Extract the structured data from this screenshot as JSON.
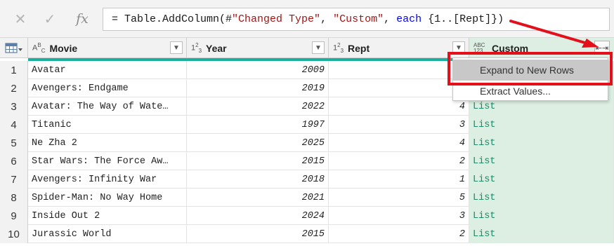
{
  "formula_bar": {
    "parts": [
      {
        "text": "= Table.AddColumn(#",
        "kind": "plain"
      },
      {
        "text": "\"Changed Type\"",
        "kind": "str"
      },
      {
        "text": ", ",
        "kind": "plain"
      },
      {
        "text": "\"Custom\"",
        "kind": "str"
      },
      {
        "text": ", ",
        "kind": "plain"
      },
      {
        "text": "each",
        "kind": "kw"
      },
      {
        "text": " {1..[Rept]})",
        "kind": "plain"
      }
    ],
    "fx_label": "fx",
    "cancel_glyph": "✕",
    "commit_glyph": "✓"
  },
  "columns": [
    {
      "name": "Movie",
      "type_badge": "ABC",
      "type_kind": "text"
    },
    {
      "name": "Year",
      "type_badge": "123",
      "type_kind": "number"
    },
    {
      "name": "Rept",
      "type_badge": "123",
      "type_kind": "number"
    },
    {
      "name": "Custom",
      "type_badge": "ABC 123",
      "type_kind": "any"
    }
  ],
  "rows": [
    {
      "idx": "1",
      "movie": "Avatar",
      "year": "2009",
      "rept": "",
      "custom": ""
    },
    {
      "idx": "2",
      "movie": "Avengers: Endgame",
      "year": "2019",
      "rept": "",
      "custom": ""
    },
    {
      "idx": "3",
      "movie": "Avatar: The Way of Wate…",
      "year": "2022",
      "rept": "4",
      "custom": "List"
    },
    {
      "idx": "4",
      "movie": "Titanic",
      "year": "1997",
      "rept": "3",
      "custom": "List"
    },
    {
      "idx": "5",
      "movie": "Ne Zha 2",
      "year": "2025",
      "rept": "4",
      "custom": "List"
    },
    {
      "idx": "6",
      "movie": "Star Wars: The Force Aw…",
      "year": "2015",
      "rept": "2",
      "custom": "List"
    },
    {
      "idx": "7",
      "movie": "Avengers: Infinity War",
      "year": "2018",
      "rept": "1",
      "custom": "List"
    },
    {
      "idx": "8",
      "movie": "Spider-Man: No Way Home",
      "year": "2021",
      "rept": "5",
      "custom": "List"
    },
    {
      "idx": "9",
      "movie": "Inside Out 2",
      "year": "2024",
      "rept": "3",
      "custom": "List"
    },
    {
      "idx": "10",
      "movie": "Jurassic World",
      "year": "2015",
      "rept": "2",
      "custom": "List"
    }
  ],
  "context_menu": {
    "items": [
      {
        "label": "Expand to New Rows",
        "highlighted": true
      },
      {
        "label": "Extract Values..."
      }
    ]
  },
  "icons": {
    "table_menu": "table-icon",
    "dropdown": "chevron-down-icon",
    "expand": "expand-arrows-icon"
  },
  "colors": {
    "annotation_red": "#e3101c",
    "custom_column_bg": "#dcefe2",
    "list_text": "#1a8a6a",
    "quality_bar": "#1ab0a0"
  }
}
